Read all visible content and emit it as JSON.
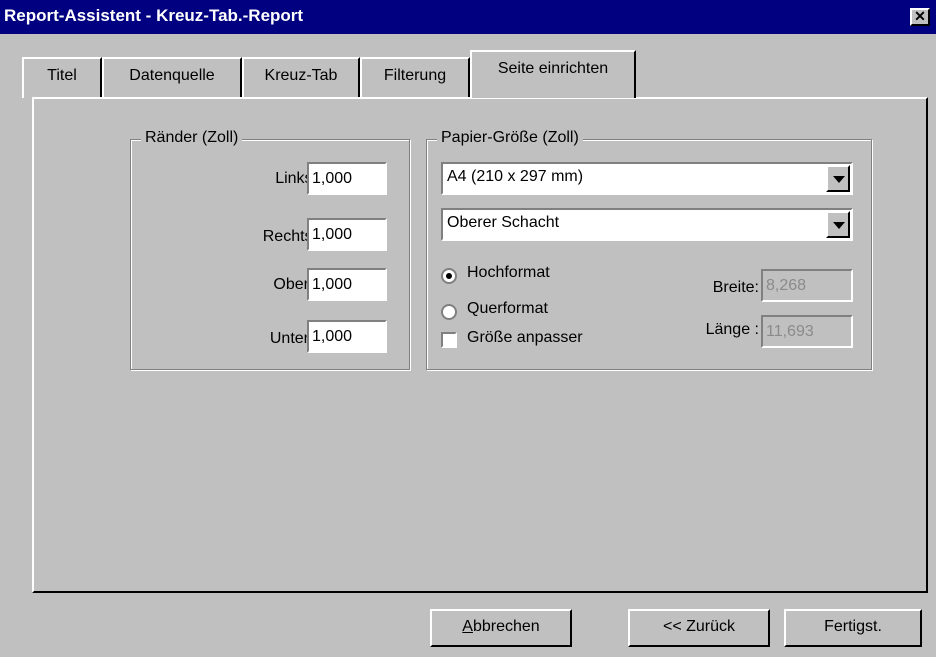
{
  "window": {
    "title": "Report-Assistent - Kreuz-Tab.-Report",
    "close_glyph": "✕"
  },
  "tabs": [
    {
      "label": "Titel"
    },
    {
      "label": "Datenquelle"
    },
    {
      "label": "Kreuz-Tab"
    },
    {
      "label": "Filterung"
    },
    {
      "label": "Seite einrichten",
      "active": true
    }
  ],
  "margins": {
    "title": "Ränder (Zoll)",
    "left_label": "Links:",
    "left_value": "1,000",
    "right_label": "Rechts:",
    "right_value": "1,000",
    "top_label": "Oben:",
    "top_value": "1,000",
    "bottom_label": "Unten:",
    "bottom_value": "1,000"
  },
  "paper": {
    "title": "Papier-Größe (Zoll)",
    "size_value": "A4 (210 x 297 mm)",
    "source_value": "Oberer Schacht",
    "portrait_label": "Hochformat",
    "landscape_label": "Querformat",
    "orientation": "portrait",
    "fit_label": "Größe anpasser",
    "fit_checked": false,
    "width_label": "Breite:",
    "width_value": "8,268",
    "length_label": "Länge :",
    "length_value": "11,693"
  },
  "buttons": {
    "cancel_mnemonic": "A",
    "cancel_rest": "bbrechen",
    "back": "<< Zurück",
    "finish": "Fertigst."
  },
  "colors": {
    "title_bar": "#000080",
    "face": "#c0c0c0"
  }
}
